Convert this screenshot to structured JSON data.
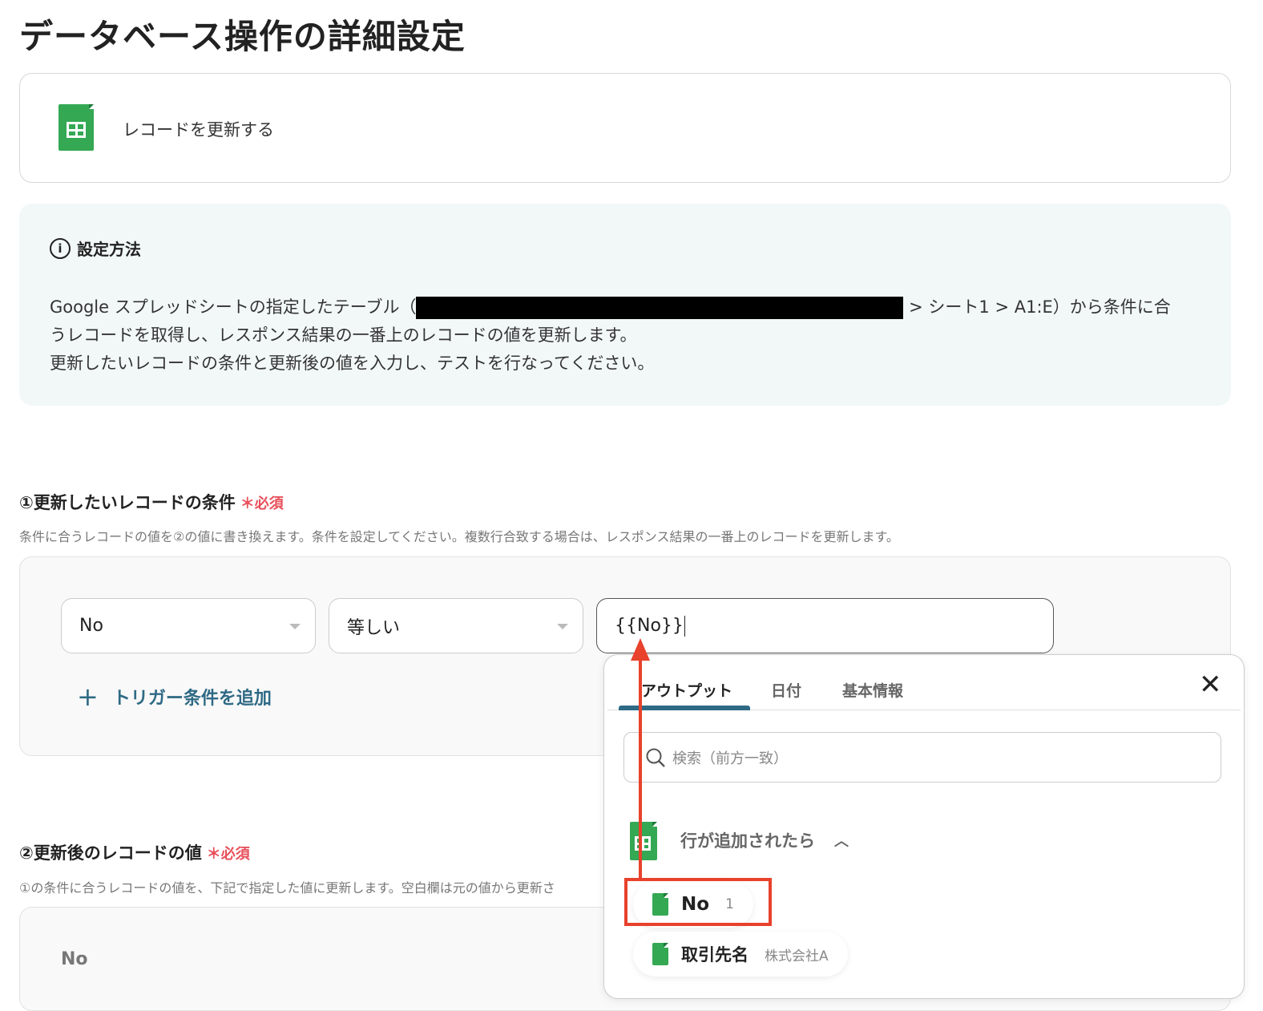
{
  "page_title": "データベース操作の詳細設定",
  "action": {
    "label": "レコードを更新する",
    "icon": "google-sheets-icon"
  },
  "info": {
    "title": "設定方法",
    "line1_pre": "Google スプレッドシートの指定したテーブル（",
    "line1_post": " > シート1 > A1:E）から条件に合",
    "line2": "うレコードを取得し、レスポンス結果の一番上のレコードの値を更新します。",
    "line3": "更新したいレコードの条件と更新後の値を入力し、テストを行なってください。"
  },
  "section1": {
    "title": "①更新したいレコードの条件",
    "required": "＊必須",
    "description": "条件に合うレコードの値を②の値に書き換えます。条件を設定してください。複数行合致する場合は、レスポンス結果の一番上のレコードを更新します。",
    "field_select": "No",
    "operator_select": "等しい",
    "value_input": "{{No}}",
    "add_condition": "トリガー条件を追加"
  },
  "section2": {
    "title": "②更新後のレコードの値",
    "required": "＊必須",
    "description": "①の条件に合うレコードの値を、下記で指定した値に更新します。空白欄は元の値から更新さ",
    "field_label": "No"
  },
  "popup": {
    "tabs": [
      "アウトプット",
      "日付",
      "基本情報"
    ],
    "active_tab": "アウトプット",
    "search_placeholder": "検索（前方一致）",
    "group_title": "行が追加されたら",
    "items": [
      {
        "name": "No",
        "value": "1"
      },
      {
        "name": "取引先名",
        "value": "株式会社A"
      }
    ]
  },
  "colors": {
    "accent": "#2f6a85",
    "required": "#e8505b",
    "highlight": "#e8412c",
    "sheets_green": "#34a853"
  }
}
